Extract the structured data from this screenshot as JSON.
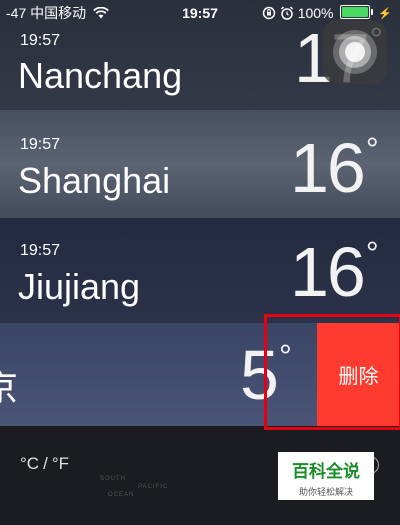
{
  "status": {
    "signal": "-47",
    "carrier": "中国移动",
    "time": "19:57",
    "battery": "100%",
    "battery_level": 1.0
  },
  "cities": [
    {
      "time": "19:57",
      "name": "Nanchang",
      "temp": "17",
      "deg": "°"
    },
    {
      "time": "19:57",
      "name": "Shanghai",
      "temp": "16",
      "deg": "°"
    },
    {
      "time": "19:57",
      "name": "Jiujiang",
      "temp": "16",
      "deg": "°"
    },
    {
      "time": "",
      "name": "京",
      "temp": "5",
      "deg": "°"
    }
  ],
  "delete_label": "删除",
  "footer": {
    "unit_c": "°C",
    "unit_sep": "/",
    "unit_f": "°F"
  },
  "watermark": {
    "title": "百科全说",
    "subtitle": "助你轻松解决"
  },
  "map_labels": [
    "SOUTH",
    "PACIFIC",
    "OCEAN"
  ],
  "colors": {
    "delete": "#ff3b30",
    "highlight": "#e60012",
    "battery": "#4cd964"
  }
}
